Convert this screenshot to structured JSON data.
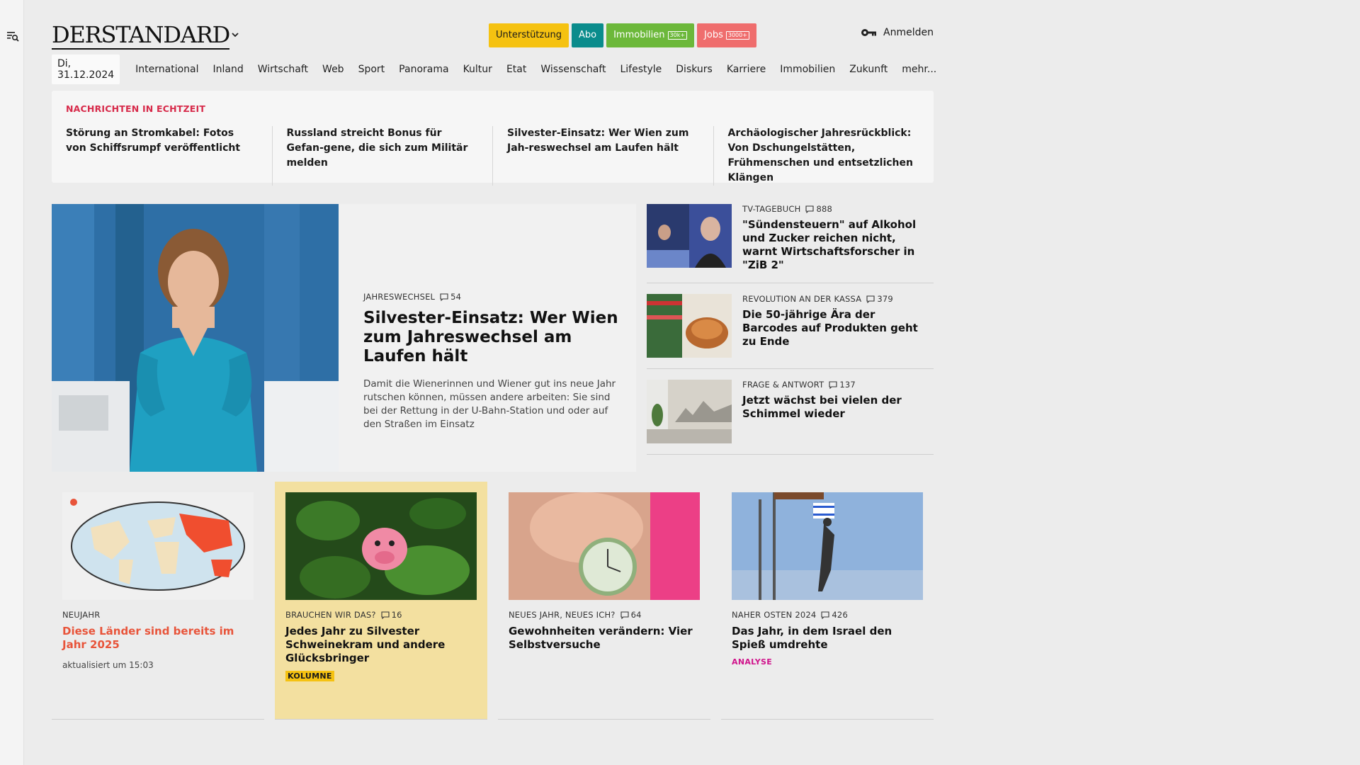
{
  "header": {
    "logo": "DERSTANDARD",
    "pills": [
      {
        "label": "Unterstützung",
        "bg": "#f5c211",
        "fg": "#1a1a1a",
        "badge": ""
      },
      {
        "label": "Abo",
        "bg": "#0a8c8c",
        "fg": "#ffffff",
        "badge": ""
      },
      {
        "label": "Immobilien",
        "bg": "#6cb83a",
        "fg": "#ffffff",
        "badge": "30k+"
      },
      {
        "label": "Jobs",
        "bg": "#ef6d6d",
        "fg": "#ffffff",
        "badge": "3000+"
      }
    ],
    "login": "Anmelden"
  },
  "nav": {
    "date": "Di, 31.12.2024",
    "items": [
      "International",
      "Inland",
      "Wirtschaft",
      "Web",
      "Sport",
      "Panorama",
      "Kultur",
      "Etat",
      "Wissenschaft",
      "Lifestyle",
      "Diskurs",
      "Karriere",
      "Immobilien",
      "Zukunft",
      "mehr..."
    ]
  },
  "ticker": {
    "label": "NACHRICHTEN IN ECHTZEIT",
    "items": [
      "Störung an Stromkabel: Fotos von Schiffsrumpf veröffentlicht",
      "Russland streicht Bonus für Gefan-gene, die sich zum Militär melden",
      "Silvester-Einsatz: Wer Wien zum Jah-reswechsel am Laufen hält",
      "Archäologischer Jahresrückblick: Von Dschungelstätten, Frühmenschen und entsetzlichen Klängen"
    ]
  },
  "lead": {
    "kicker": "JAHRESWECHSEL",
    "comments": "54",
    "title": "Silvester-Einsatz: Wer Wien zum Jahreswechsel am Laufen hält",
    "teaser": "Damit die Wienerinnen und Wiener gut ins neue Jahr rutschen können, müssen andere arbeiten: Sie sind bei der Rettung in der U-Bahn-Station und oder auf den Straßen im Einsatz"
  },
  "side": [
    {
      "kicker": "TV-TAGEBUCH",
      "comments": "888",
      "title": "\"Sündensteuern\" auf Alkohol und Zucker reichen nicht, warnt Wirtschaftsforscher in \"ZiB 2\""
    },
    {
      "kicker": "REVOLUTION AN DER KASSA",
      "comments": "379",
      "title": "Die 50-jährige Ära der Barcodes auf Produkten geht zu Ende"
    },
    {
      "kicker": "FRAGE & ANTWORT",
      "comments": "137",
      "title": "Jetzt wächst bei vielen der Schimmel wieder"
    }
  ],
  "teasers": [
    {
      "kicker": "NEUJAHR",
      "comments": "",
      "title": "Diese Länder sind bereits im Jahr 2025",
      "tag": "",
      "small": "aktualisiert um 15:03"
    },
    {
      "kicker": "BRAUCHEN WIR DAS?",
      "comments": "16",
      "title": "Jedes Jahr zu Silvester Schweinekram und andere Glücksbringer",
      "tag": "KOLUMNE",
      "small": ""
    },
    {
      "kicker": "NEUES JAHR, NEUES ICH?",
      "comments": "64",
      "title": "Gewohnheiten verändern: Vier Selbstversuche",
      "tag": "",
      "small": ""
    },
    {
      "kicker": "NAHER OSTEN 2024",
      "comments": "426",
      "title": "Das Jahr, in dem Israel den Spieß umdrehte",
      "tag": "ANALYSE",
      "small": ""
    }
  ],
  "colors": {
    "live_red": "#d72a4a",
    "neujahr_red": "#e8543a",
    "column_bg": "#f3e0a0",
    "analysis_magenta": "#d0148c",
    "kolumne_tag_bg": "#f5c211"
  }
}
